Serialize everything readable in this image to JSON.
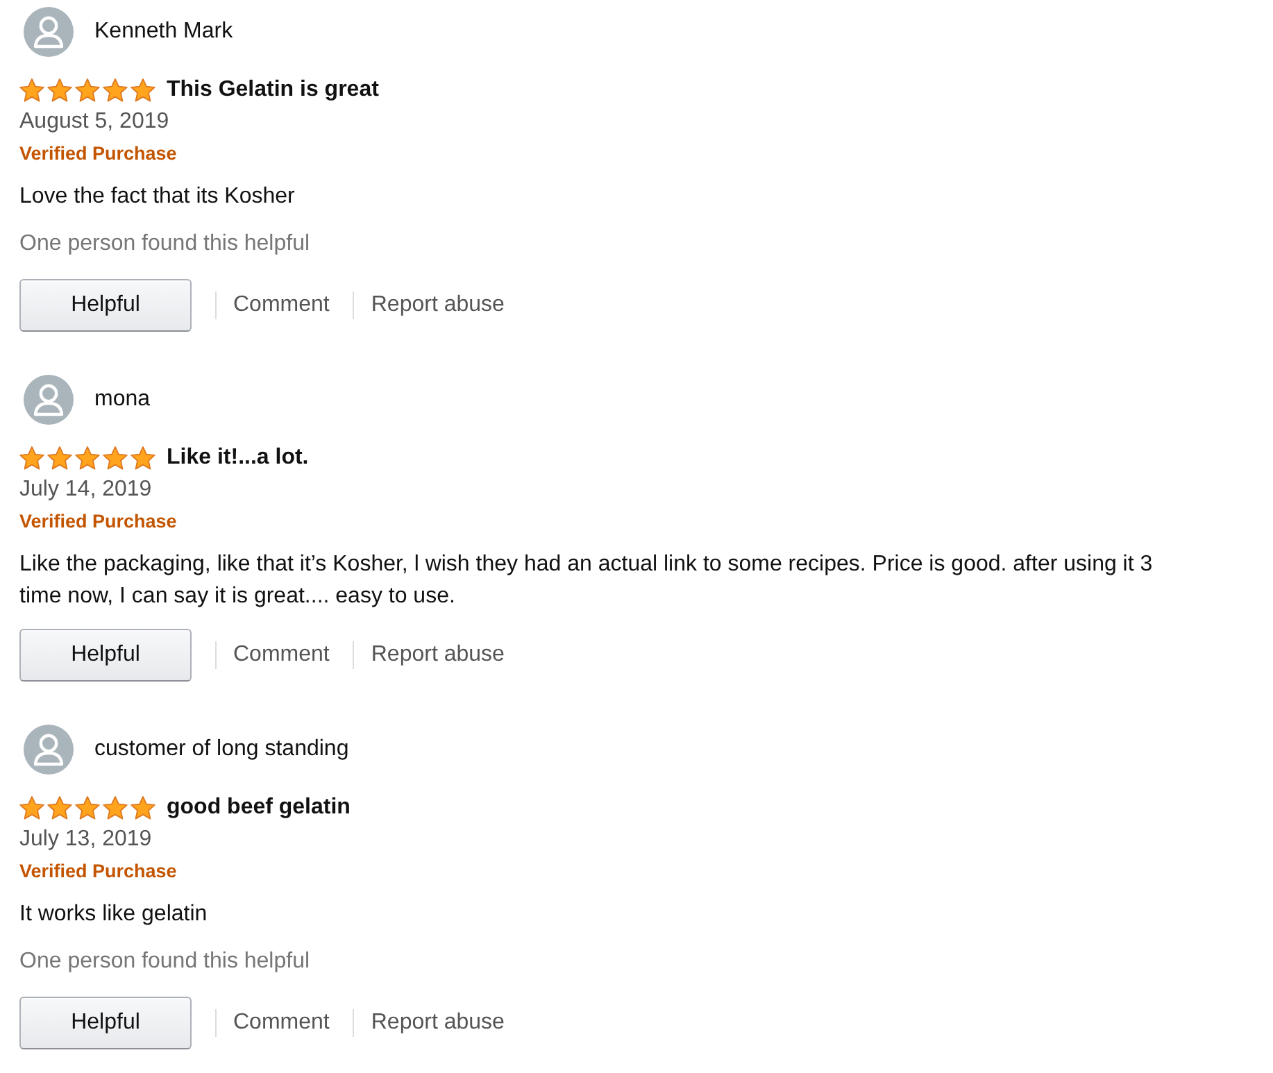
{
  "reviews": [
    {
      "reviewer": "Kenneth Mark",
      "stars": 5,
      "title": "This Gelatin is great",
      "date": "August 5, 2019",
      "badge": "Verified Purchase",
      "body": "Love the fact that its Kosher",
      "helpful_count": "One person found this helpful",
      "actions": [
        {
          "kind": "button",
          "label": "Helpful"
        },
        {
          "kind": "link",
          "label": "Comment"
        },
        {
          "kind": "link",
          "label": "Report abuse"
        }
      ]
    },
    {
      "reviewer": "mona",
      "stars": 5,
      "title": "Like it!...a lot.",
      "date": "July 14, 2019",
      "badge": "Verified Purchase",
      "body": "Like the packaging, like that it’s Kosher, l wish they had an actual link to some recipes. Price is good. after using it 3 time now, I can say it is great.... easy to use.",
      "actions": [
        {
          "kind": "button",
          "label": "Helpful"
        },
        {
          "kind": "link",
          "label": "Comment"
        },
        {
          "kind": "link",
          "label": "Report abuse"
        }
      ]
    },
    {
      "reviewer": "customer of long standing",
      "stars": 5,
      "title": "good beef gelatin",
      "date": "July 13, 2019",
      "badge": "Verified Purchase",
      "body": "It works like gelatin",
      "helpful_count": "One person found this helpful",
      "actions": [
        {
          "kind": "button",
          "label": "Helpful"
        },
        {
          "kind": "link",
          "label": "Comment"
        },
        {
          "kind": "link",
          "label": "Report abuse"
        }
      ]
    }
  ]
}
